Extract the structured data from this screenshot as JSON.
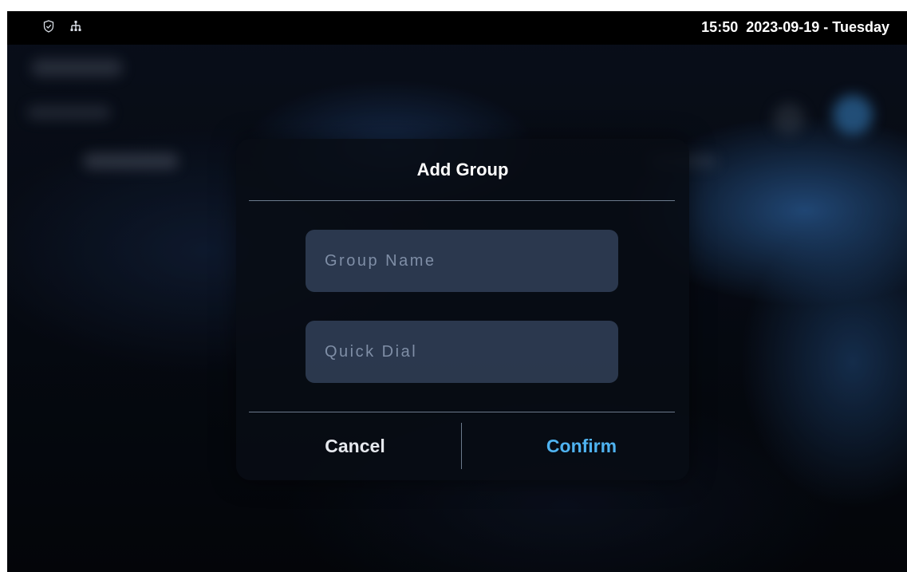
{
  "status_bar": {
    "icons": [
      "shield-check-icon",
      "network-icon"
    ],
    "time": "15:50",
    "date": "2023-09-19 - Tuesday"
  },
  "dialog": {
    "title": "Add Group",
    "group_name": {
      "value": "",
      "placeholder": "Group Name"
    },
    "quick_dial": {
      "value": "",
      "placeholder": "Quick Dial"
    },
    "cancel_label": "Cancel",
    "confirm_label": "Confirm"
  },
  "colors": {
    "confirm_accent": "#4fb3f0",
    "status_bar_bg": "#000000",
    "field_bg": "#485c7d"
  }
}
